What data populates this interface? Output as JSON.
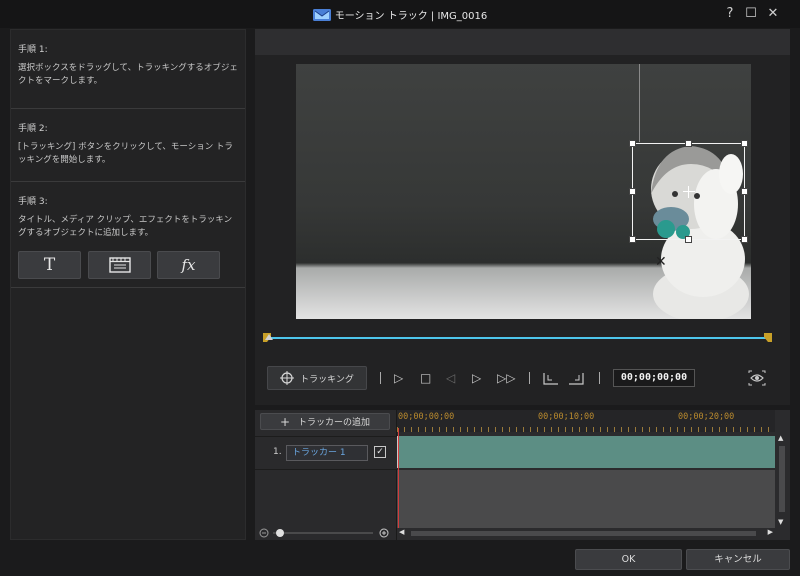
{
  "window": {
    "title": "モーション トラック  |  IMG_0016",
    "help_glyph": "?",
    "maximize_glyph": "☐",
    "close_glyph": "✕"
  },
  "steps": [
    {
      "title": "手順 1:",
      "text": "選択ボックスをドラッグして、トラッキングするオブジェクトをマークします。"
    },
    {
      "title": "手順 2:",
      "text": "[トラッキング] ボタンをクリックして、モーション トラッキングを開始します。"
    },
    {
      "title": "手順 3:",
      "text": "タイトル、メディア クリップ、エフェクトをトラッキングするオブジェクトに追加します。"
    }
  ],
  "add_buttons": [
    {
      "glyph": "T",
      "icon": "title-icon"
    },
    {
      "glyph": "",
      "icon": "media-clip-icon"
    },
    {
      "glyph": "fx",
      "icon": "effect-icon"
    }
  ],
  "player": {
    "tracking_label": "トラッキング",
    "timecode": "00;00;00;00"
  },
  "timeline": {
    "add_tracker_label": "トラッカーの追加",
    "ruler": [
      "00;00;00;00",
      "00;00;10;00",
      "00;00;20;00"
    ],
    "tracks": [
      {
        "index": "1.",
        "name": "トラッカー 1",
        "checked": true
      }
    ]
  },
  "footer": {
    "ok_label": "OK",
    "cancel_label": "キャンセル"
  },
  "colors": {
    "accent": "#4ec6ec",
    "clip": "#5c8e84",
    "playhead": "#d43a3a",
    "marker": "#c8a028"
  }
}
